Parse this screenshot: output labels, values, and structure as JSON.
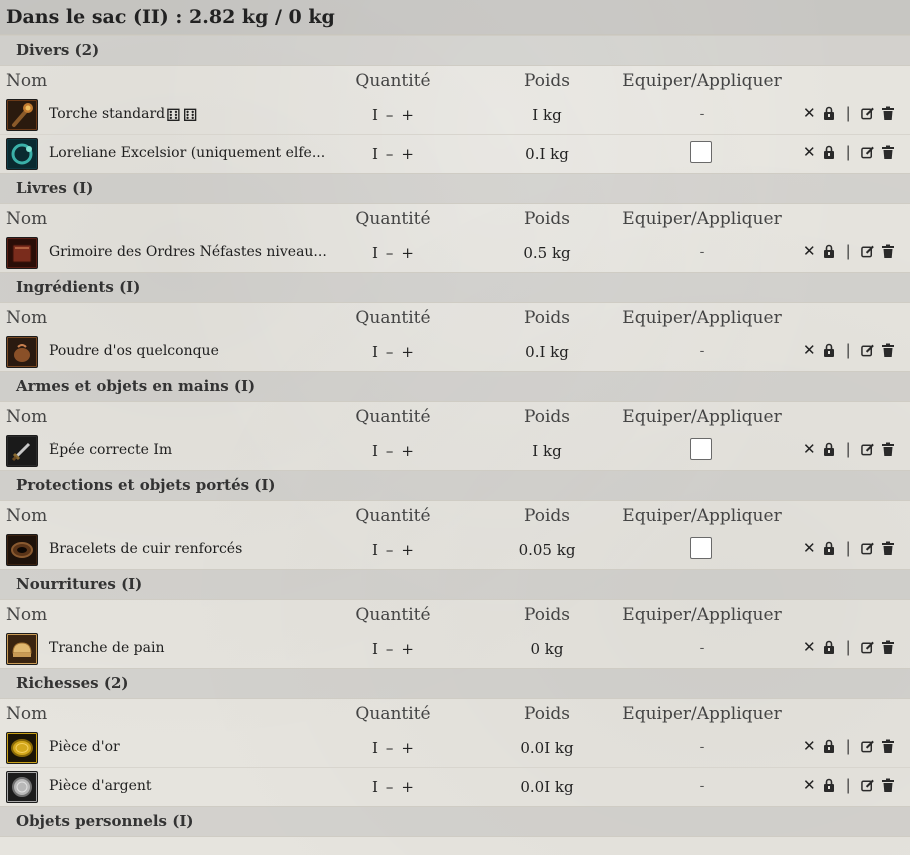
{
  "bag": {
    "title": "Dans le sac (II) :  2.82 kg / 0 kg"
  },
  "columns": {
    "name": "Nom",
    "quantity": "Quantité",
    "weight": "Poids",
    "equip": "Equiper/Appliquer"
  },
  "qty_controls": {
    "minus": "–",
    "plus": "+"
  },
  "actions": {
    "remove": "✕",
    "separator": "|"
  },
  "categories": [
    {
      "title": "Divers (2)",
      "items": [
        {
          "name": "Torche standard",
          "dice": "⚅⚅",
          "qty": "I",
          "weight": "I kg",
          "equip": "-",
          "icon": "torch-icon",
          "color": "#6b3a18"
        },
        {
          "name": "Loreliane Excelsior (uniquement elfe...",
          "qty": "I",
          "weight": "0.I kg",
          "equip": "checkbox",
          "icon": "ring-icon",
          "color": "#0f3b45"
        }
      ]
    },
    {
      "title": "Livres (I)",
      "items": [
        {
          "name": "Grimoire des Ordres Néfastes niveau...",
          "qty": "I",
          "weight": "0.5 kg",
          "equip": "-",
          "icon": "book-icon",
          "color": "#5a1e14"
        }
      ]
    },
    {
      "title": "Ingrédients (I)",
      "items": [
        {
          "name": "Poudre d'os quelconque",
          "qty": "I",
          "weight": "0.I kg",
          "equip": "-",
          "icon": "pouch-icon",
          "color": "#7a4a24"
        }
      ]
    },
    {
      "title": "Armes et objets en mains (I)",
      "items": [
        {
          "name": "Épée correcte Im",
          "qty": "I",
          "weight": "I kg",
          "equip": "checkbox",
          "icon": "sword-icon",
          "color": "#2a2a2a"
        }
      ]
    },
    {
      "title": "Protections et objets portés (I)",
      "items": [
        {
          "name": "Bracelets de cuir renforcés",
          "qty": "I",
          "weight": "0.05 kg",
          "equip": "checkbox",
          "icon": "bracelet-icon",
          "color": "#3b2210"
        }
      ]
    },
    {
      "title": "Nourritures (I)",
      "items": [
        {
          "name": "Tranche de pain",
          "qty": "I",
          "weight": "0 kg",
          "equip": "-",
          "icon": "bread-icon",
          "color": "#c89a55"
        }
      ]
    },
    {
      "title": "Richesses (2)",
      "items": [
        {
          "name": "Pièce d'or",
          "qty": "I",
          "weight": "0.0I kg",
          "equip": "-",
          "icon": "gold-coin-icon",
          "color": "#c8a018"
        },
        {
          "name": "Pièce d'argent",
          "qty": "I",
          "weight": "0.0I kg",
          "equip": "-",
          "icon": "silver-coin-icon",
          "color": "#a9a9a9"
        }
      ]
    },
    {
      "title": "Objets personnels (I)",
      "items": []
    }
  ]
}
